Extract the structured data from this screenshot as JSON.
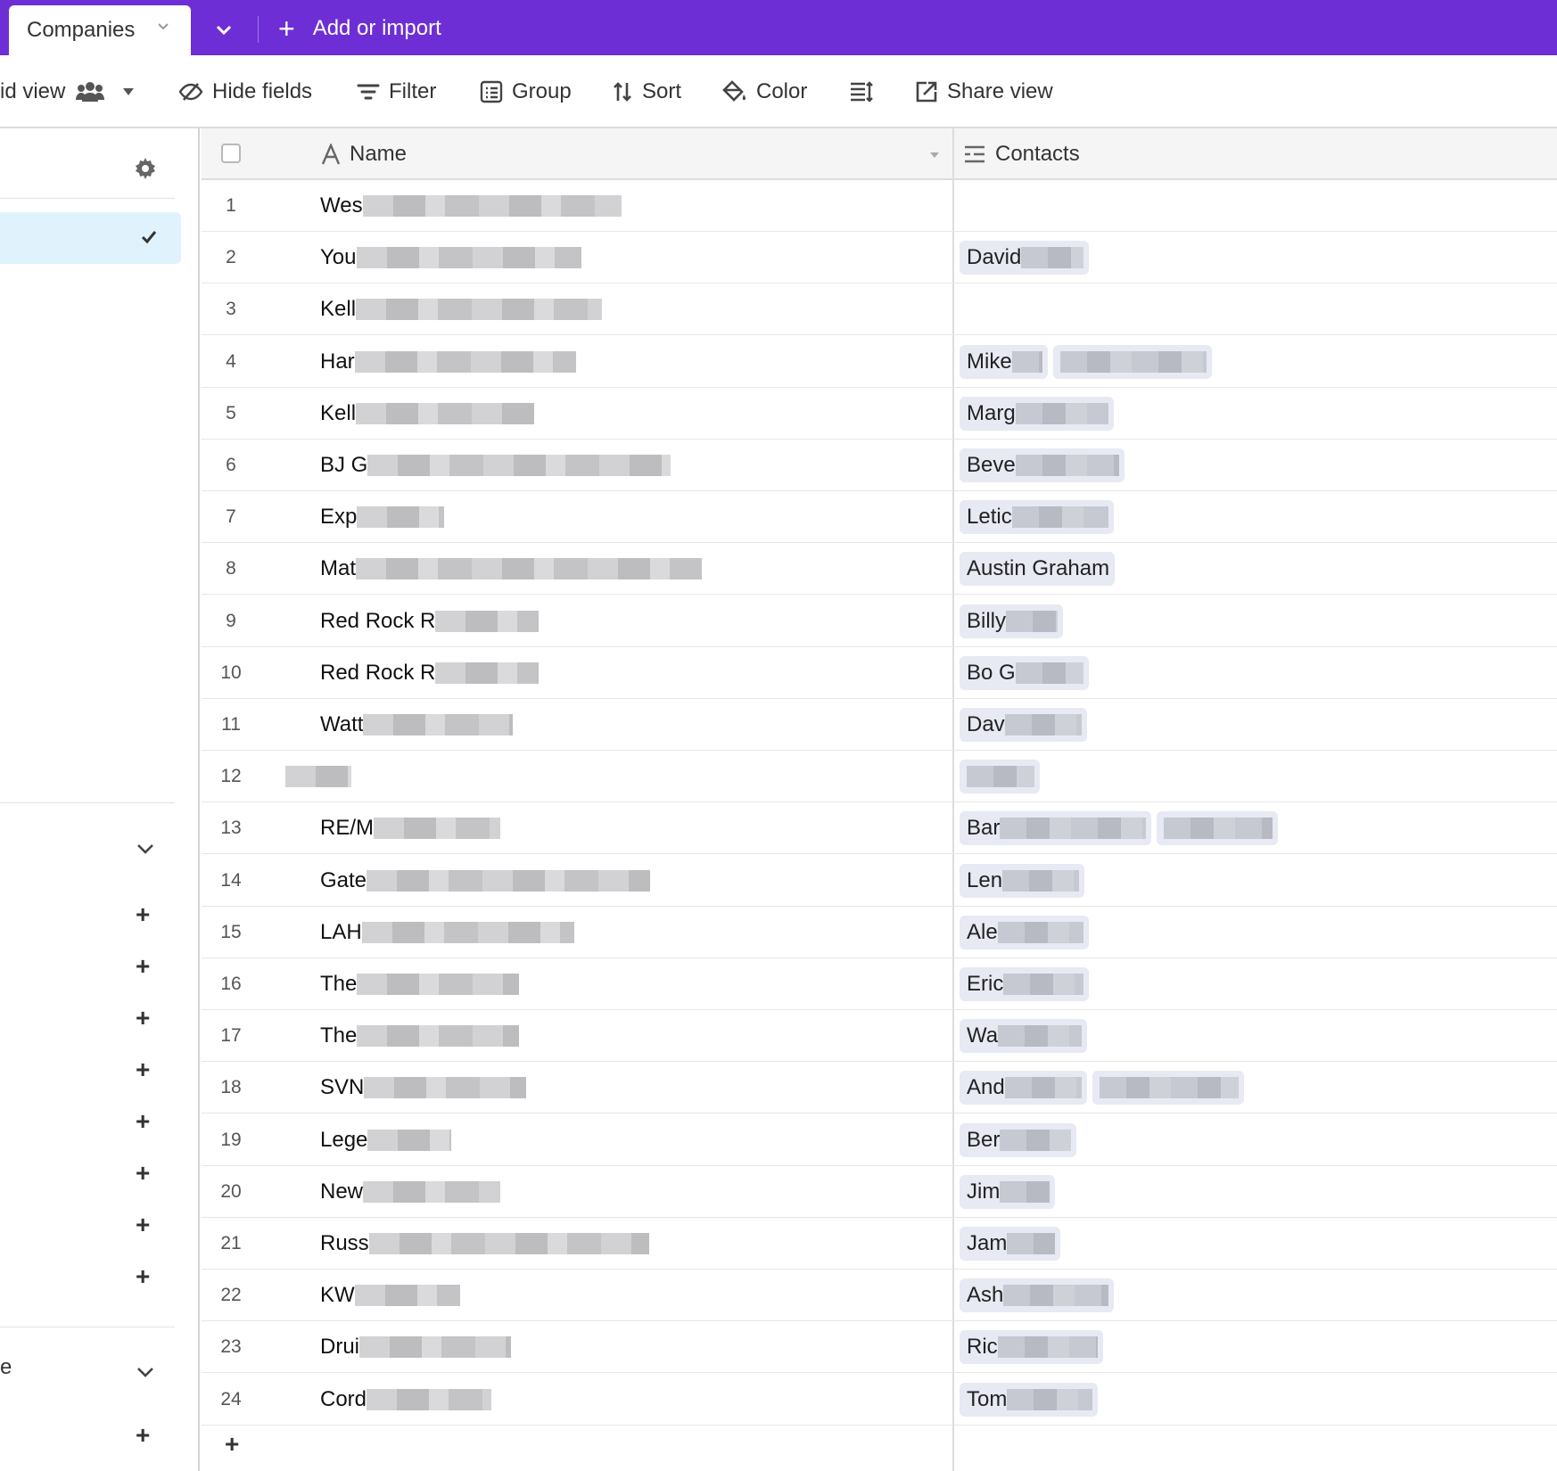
{
  "tabs": {
    "active_table": "Companies",
    "add_label": "Add or import"
  },
  "toolbar": {
    "view_name": "id view",
    "hide_fields": "Hide fields",
    "filter": "Filter",
    "group": "Group",
    "sort": "Sort",
    "color": "Color",
    "share_view": "Share view"
  },
  "sidebar": {
    "bottom_label": "e"
  },
  "columns": {
    "name": "Name",
    "contacts": "Contacts"
  },
  "rows": [
    {
      "n": "1",
      "name": "Wes",
      "contacts": []
    },
    {
      "n": "2",
      "name": "You",
      "contacts": [
        "David"
      ]
    },
    {
      "n": "3",
      "name": "Kell",
      "contacts": []
    },
    {
      "n": "4",
      "name": "Har",
      "contacts": [
        "Mike",
        ""
      ]
    },
    {
      "n": "5",
      "name": "Kell",
      "contacts": [
        "Marg"
      ]
    },
    {
      "n": "6",
      "name": "BJ G",
      "contacts": [
        "Beve"
      ]
    },
    {
      "n": "7",
      "name": "Exp",
      "contacts": [
        "Letic"
      ]
    },
    {
      "n": "8",
      "name": "Mat",
      "contacts": [
        "Austin Graham"
      ]
    },
    {
      "n": "9",
      "name": "Red Rock R",
      "contacts": [
        "Billy"
      ]
    },
    {
      "n": "10",
      "name": "Red Rock R",
      "contacts": [
        "Bo G"
      ]
    },
    {
      "n": "11",
      "name": "Watt",
      "contacts": [
        "Dav"
      ]
    },
    {
      "n": "12",
      "name": "",
      "contacts": [
        ""
      ]
    },
    {
      "n": "13",
      "name": "RE/M",
      "contacts": [
        "Bar",
        ""
      ]
    },
    {
      "n": "14",
      "name": "Gate",
      "contacts": [
        "Len"
      ]
    },
    {
      "n": "15",
      "name": "LAH",
      "contacts": [
        "Ale"
      ]
    },
    {
      "n": "16",
      "name": "The",
      "contacts": [
        "Eric"
      ]
    },
    {
      "n": "17",
      "name": "The",
      "contacts": [
        "Wa"
      ]
    },
    {
      "n": "18",
      "name": "SVN",
      "contacts": [
        "And",
        ""
      ]
    },
    {
      "n": "19",
      "name": "Lege",
      "contacts": [
        "Ber"
      ]
    },
    {
      "n": "20",
      "name": "New",
      "contacts": [
        "Jim"
      ]
    },
    {
      "n": "21",
      "name": "Russ",
      "contacts": [
        "Jam"
      ]
    },
    {
      "n": "22",
      "name": "KW",
      "contacts": [
        "Ash"
      ]
    },
    {
      "n": "23",
      "name": "Drui",
      "contacts": [
        "Ric"
      ]
    },
    {
      "n": "24",
      "name": "Cord",
      "contacts": [
        "Tom"
      ]
    }
  ],
  "icons": {
    "tab_chevron": "chevron-down-icon",
    "people": "people-icon",
    "gear": "gear-icon",
    "check": "check-icon",
    "text_field": "text-field-icon",
    "link_field": "linked-record-icon"
  },
  "colors": {
    "brand": "#6d2fd5",
    "selected_view": "#e0f3fc",
    "chip": "#e7e9f3"
  }
}
